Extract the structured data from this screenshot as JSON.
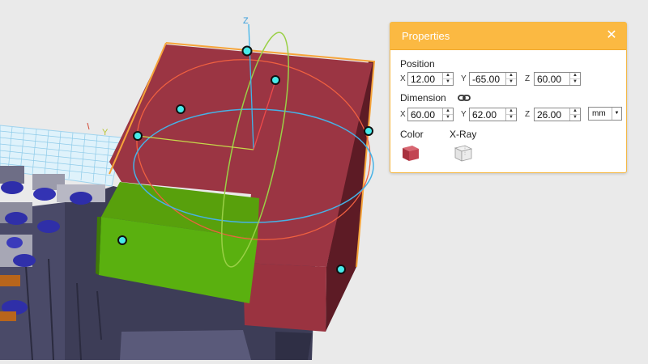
{
  "viewport": {
    "axis_labels": {
      "z": "Z",
      "y": "Y"
    },
    "colors": {
      "red_box": "#9b3543",
      "green_box": "#5aa30d",
      "dark_base": "#3d3d57"
    }
  },
  "properties_panel": {
    "title": "Properties",
    "close_icon": "close-icon",
    "position": {
      "label": "Position",
      "x_label": "X",
      "x_value": "12.00",
      "y_label": "Y",
      "y_value": "-65.00",
      "z_label": "Z",
      "z_value": "60.00"
    },
    "dimension": {
      "label": "Dimension",
      "link_icon": "link-icon",
      "x_label": "X",
      "x_value": "60.00",
      "y_label": "Y",
      "y_value": "62.00",
      "z_label": "Z",
      "z_value": "26.00",
      "unit": "mm"
    },
    "color": {
      "label": "Color",
      "swatch": "#b7444f"
    },
    "xray": {
      "label": "X-Ray"
    }
  }
}
